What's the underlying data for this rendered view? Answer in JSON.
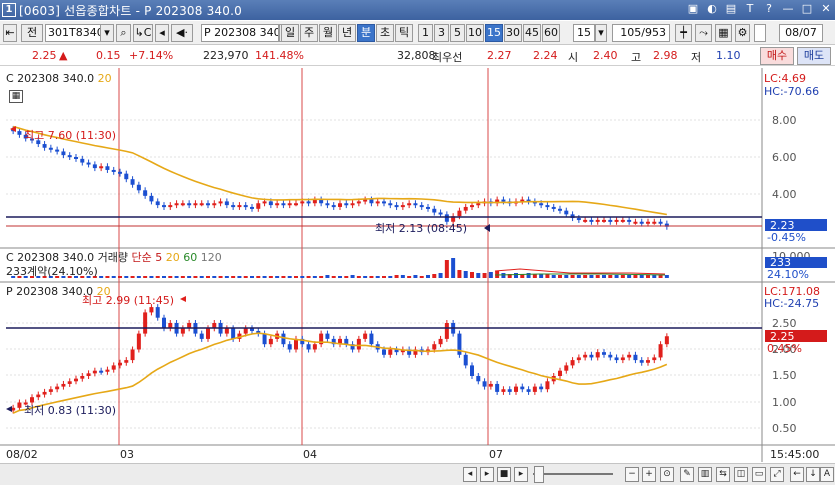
{
  "window": {
    "number": "1",
    "title": "[0603] 선옵종합차트 - P 202308 340.0",
    "buttons": [
      "▣",
      "◐",
      "▤",
      "T",
      "?",
      "—",
      "□",
      "✕"
    ]
  },
  "toolbar": {
    "jeon": "전",
    "code": "301T8340",
    "option": "P 202308 340",
    "periods": [
      "일",
      "주",
      "월",
      "년",
      "분",
      "초",
      "틱"
    ],
    "selected_period": "분",
    "intervals": [
      "1",
      "3",
      "5",
      "10",
      "15",
      "30",
      "45",
      "60"
    ],
    "selected_interval": "15",
    "interval_value": "15",
    "count": "105/953",
    "date": "08/07"
  },
  "price_row": {
    "current": "2.25",
    "change": "0.15",
    "change_pct": "+7.14%",
    "volume": "223,970",
    "volume_pct": "141.48%",
    "best_qty": "32,808",
    "best_label": "최우선",
    "best_ask": "2.27",
    "best_bid": "2.24",
    "open_label": "시",
    "open": "2.40",
    "high_label": "고",
    "high": "2.98",
    "low_label": "저",
    "low": "1.10",
    "buy_btn": "매수",
    "sell_btn": "매도"
  },
  "pane1": {
    "label": "C 202308 340.0",
    "ma": "20",
    "max_text": "최고 7.60 (11:30)",
    "min_text": "최저 2.13 (08:45)",
    "lc": "LC:4.69",
    "hc": "HC:-70.66",
    "price_tag": "2.23",
    "pct_tag": "-0.45%",
    "yticks": [
      "8.00",
      "6.00",
      "4.00"
    ]
  },
  "pane2": {
    "label": "C 202308 340.0 거래량",
    "ma_label": "단순",
    "ma_vals": [
      "5",
      "20",
      "60",
      "120"
    ],
    "sub": "233계약(24.10%)",
    "tag1": "233",
    "tag2": "24.10%",
    "ytick": "10,000"
  },
  "pane3": {
    "label": "P 202308 340.0",
    "ma": "20",
    "max_text": "최고 2.99 (11:45)",
    "min_text": "최저 0.83 (11:30)",
    "lc": "LC:171.08",
    "hc": "HC:-24.75",
    "price_tag": "2.25",
    "pct_tag": "0.45%",
    "yticks": [
      "2.50",
      "2.00",
      "1.50",
      "1.00",
      "0.50"
    ]
  },
  "xaxis": {
    "labels": [
      "08/02",
      "03",
      "04",
      "07"
    ],
    "time": "15:45:00"
  },
  "colors": {
    "up": "#e0201c",
    "down": "#1b4fd1",
    "ma": "#e6a817",
    "vline": "#d84a4a",
    "hline": "#1c1c5c"
  },
  "chart_data": {
    "type": "candlestick",
    "c_close": [
      7.4,
      7.2,
      7.0,
      6.9,
      6.7,
      6.5,
      6.4,
      6.3,
      6.1,
      6.0,
      5.9,
      5.7,
      5.6,
      5.4,
      5.5,
      5.3,
      5.2,
      5.1,
      4.8,
      4.5,
      4.2,
      3.9,
      3.6,
      3.4,
      3.3,
      3.4,
      3.5,
      3.5,
      3.4,
      3.5,
      3.5,
      3.4,
      3.5,
      3.6,
      3.4,
      3.3,
      3.4,
      3.3,
      3.2,
      3.5,
      3.6,
      3.4,
      3.5,
      3.4,
      3.5,
      3.5,
      3.6,
      3.5,
      3.7,
      3.5,
      3.4,
      3.3,
      3.5,
      3.4,
      3.5,
      3.6,
      3.7,
      3.5,
      3.6,
      3.5,
      3.4,
      3.3,
      3.4,
      3.5,
      3.4,
      3.3,
      3.2,
      3.0,
      2.9,
      2.5,
      2.8,
      3.1,
      3.3,
      3.4,
      3.5,
      3.6,
      3.5,
      3.7,
      3.6,
      3.5,
      3.6,
      3.7,
      3.6,
      3.5,
      3.4,
      3.3,
      3.2,
      3.1,
      2.9,
      2.7,
      2.6,
      2.6,
      2.5,
      2.6,
      2.6,
      2.5,
      2.6,
      2.6,
      2.5,
      2.5,
      2.4,
      2.5,
      2.5,
      2.4,
      2.23
    ],
    "p_close": [
      0.9,
      1.0,
      1.0,
      1.1,
      1.15,
      1.2,
      1.25,
      1.3,
      1.35,
      1.4,
      1.45,
      1.5,
      1.55,
      1.6,
      1.58,
      1.62,
      1.7,
      1.75,
      1.8,
      2.0,
      2.3,
      2.7,
      2.8,
      2.6,
      2.4,
      2.5,
      2.3,
      2.4,
      2.5,
      2.3,
      2.2,
      2.4,
      2.5,
      2.3,
      2.4,
      2.2,
      2.3,
      2.4,
      2.35,
      2.3,
      2.1,
      2.2,
      2.3,
      2.1,
      2.0,
      2.2,
      2.1,
      2.0,
      2.1,
      2.3,
      2.2,
      2.1,
      2.2,
      2.1,
      2.0,
      2.2,
      2.3,
      2.1,
      2.0,
      1.9,
      2.0,
      1.95,
      2.0,
      1.9,
      2.0,
      1.95,
      2.0,
      2.1,
      2.2,
      2.5,
      2.3,
      1.9,
      1.7,
      1.5,
      1.4,
      1.3,
      1.35,
      1.2,
      1.25,
      1.2,
      1.3,
      1.25,
      1.2,
      1.3,
      1.25,
      1.4,
      1.5,
      1.6,
      1.7,
      1.8,
      1.85,
      1.9,
      1.85,
      1.95,
      1.9,
      1.85,
      1.8,
      1.85,
      1.9,
      1.8,
      1.75,
      1.8,
      1.85,
      2.1,
      2.25
    ],
    "session_breaks": [
      0,
      21,
      55,
      88
    ]
  }
}
